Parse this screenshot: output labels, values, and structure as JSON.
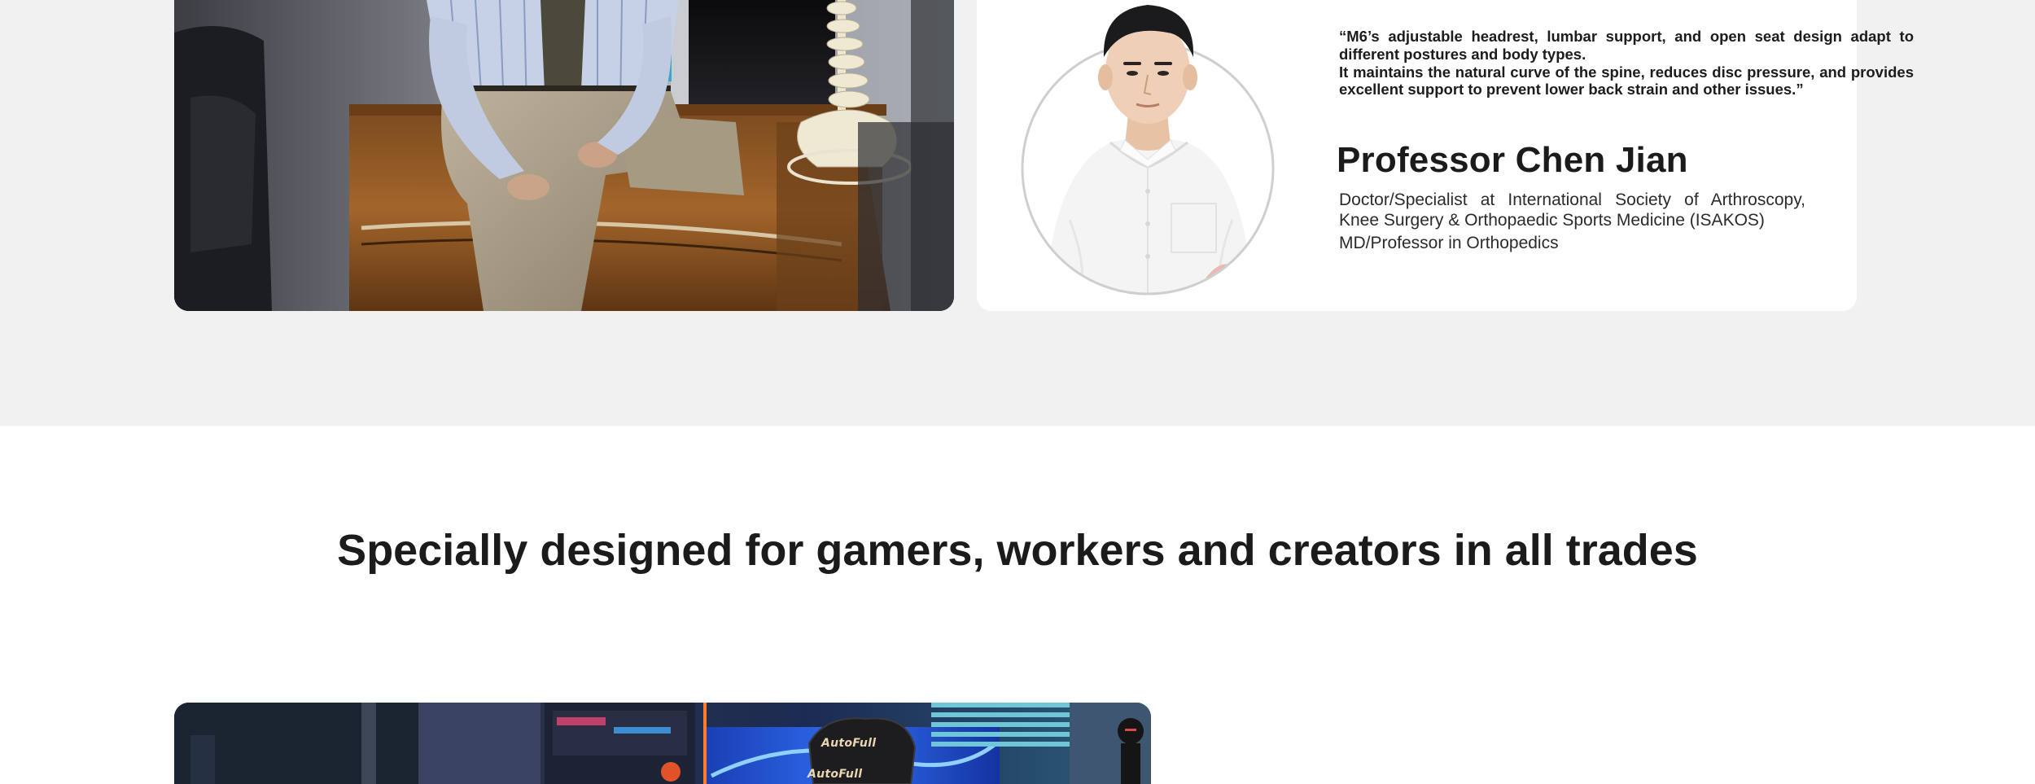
{
  "testimonial": {
    "quote_line1": "“M6’s adjustable headrest, lumbar support, and open seat design adapt to different postures and body types.",
    "quote_line2": "It maintains the natural curve of the spine, reduces disc pressure, and provides excellent support to prevent lower back strain and other issues.”",
    "name": "Professor Chen Jian",
    "role_line1": "Doctor/Specialist at International Society of Arthroscopy, Knee Surgery & Orthopaedic Sports Medicine (ISAKOS)",
    "role_line2": "MD/Professor in Orthopedics"
  },
  "section": {
    "heading": "Specially designed for gamers, workers and creators in all trades"
  },
  "gaming_photo": {
    "brand_top": "AutoFull",
    "brand_bottom": "AutoFull"
  },
  "colors": {
    "band_bg": "#f1f1f1",
    "card_bg": "#ffffff",
    "text": "#1b1b1b"
  }
}
